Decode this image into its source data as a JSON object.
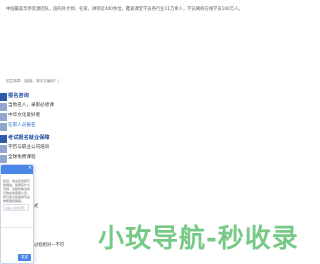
{
  "intro_text": "中国最美华侨资源团队，国内外大师、名家、讲师近400余位，覆盖课堂学员各行业11万余人，学员网校在线学员100万人。",
  "small_note": "招生简章：[链接，请中文编码？]",
  "lines": [
    {
      "text": "报名咨询",
      "style": "hdr"
    },
    {
      "text": "当地名人，录影必修课",
      "style": "normal"
    },
    {
      "text": "中华文化爱好者",
      "style": "normal"
    },
    {
      "text": "在职人员报名",
      "style": "link"
    },
    {
      "text": "考试报名就业保障",
      "style": "hdr"
    },
    {
      "text": "学历与职业公司培训",
      "style": "normal"
    },
    {
      "text": "全球免费课程",
      "style": "normal"
    }
  ],
  "chat": {
    "close_icon": "×",
    "message": "您好，欢迎来到我们的网站，如果有什么问题，请随时联系我们的在线客服人员，我们会为您提供专业的帮助和解答。",
    "input_placeholder": "请输入您的问题",
    "send_label": "发送"
  },
  "side_snippets": [
    "式",
    "过程相对一不可"
  ],
  "watermark": "小玫导航-秒收录",
  "colors": {
    "accent": "#4a86e8",
    "header_blue": "#1f4f9f",
    "watermark_green": "#68c478"
  }
}
